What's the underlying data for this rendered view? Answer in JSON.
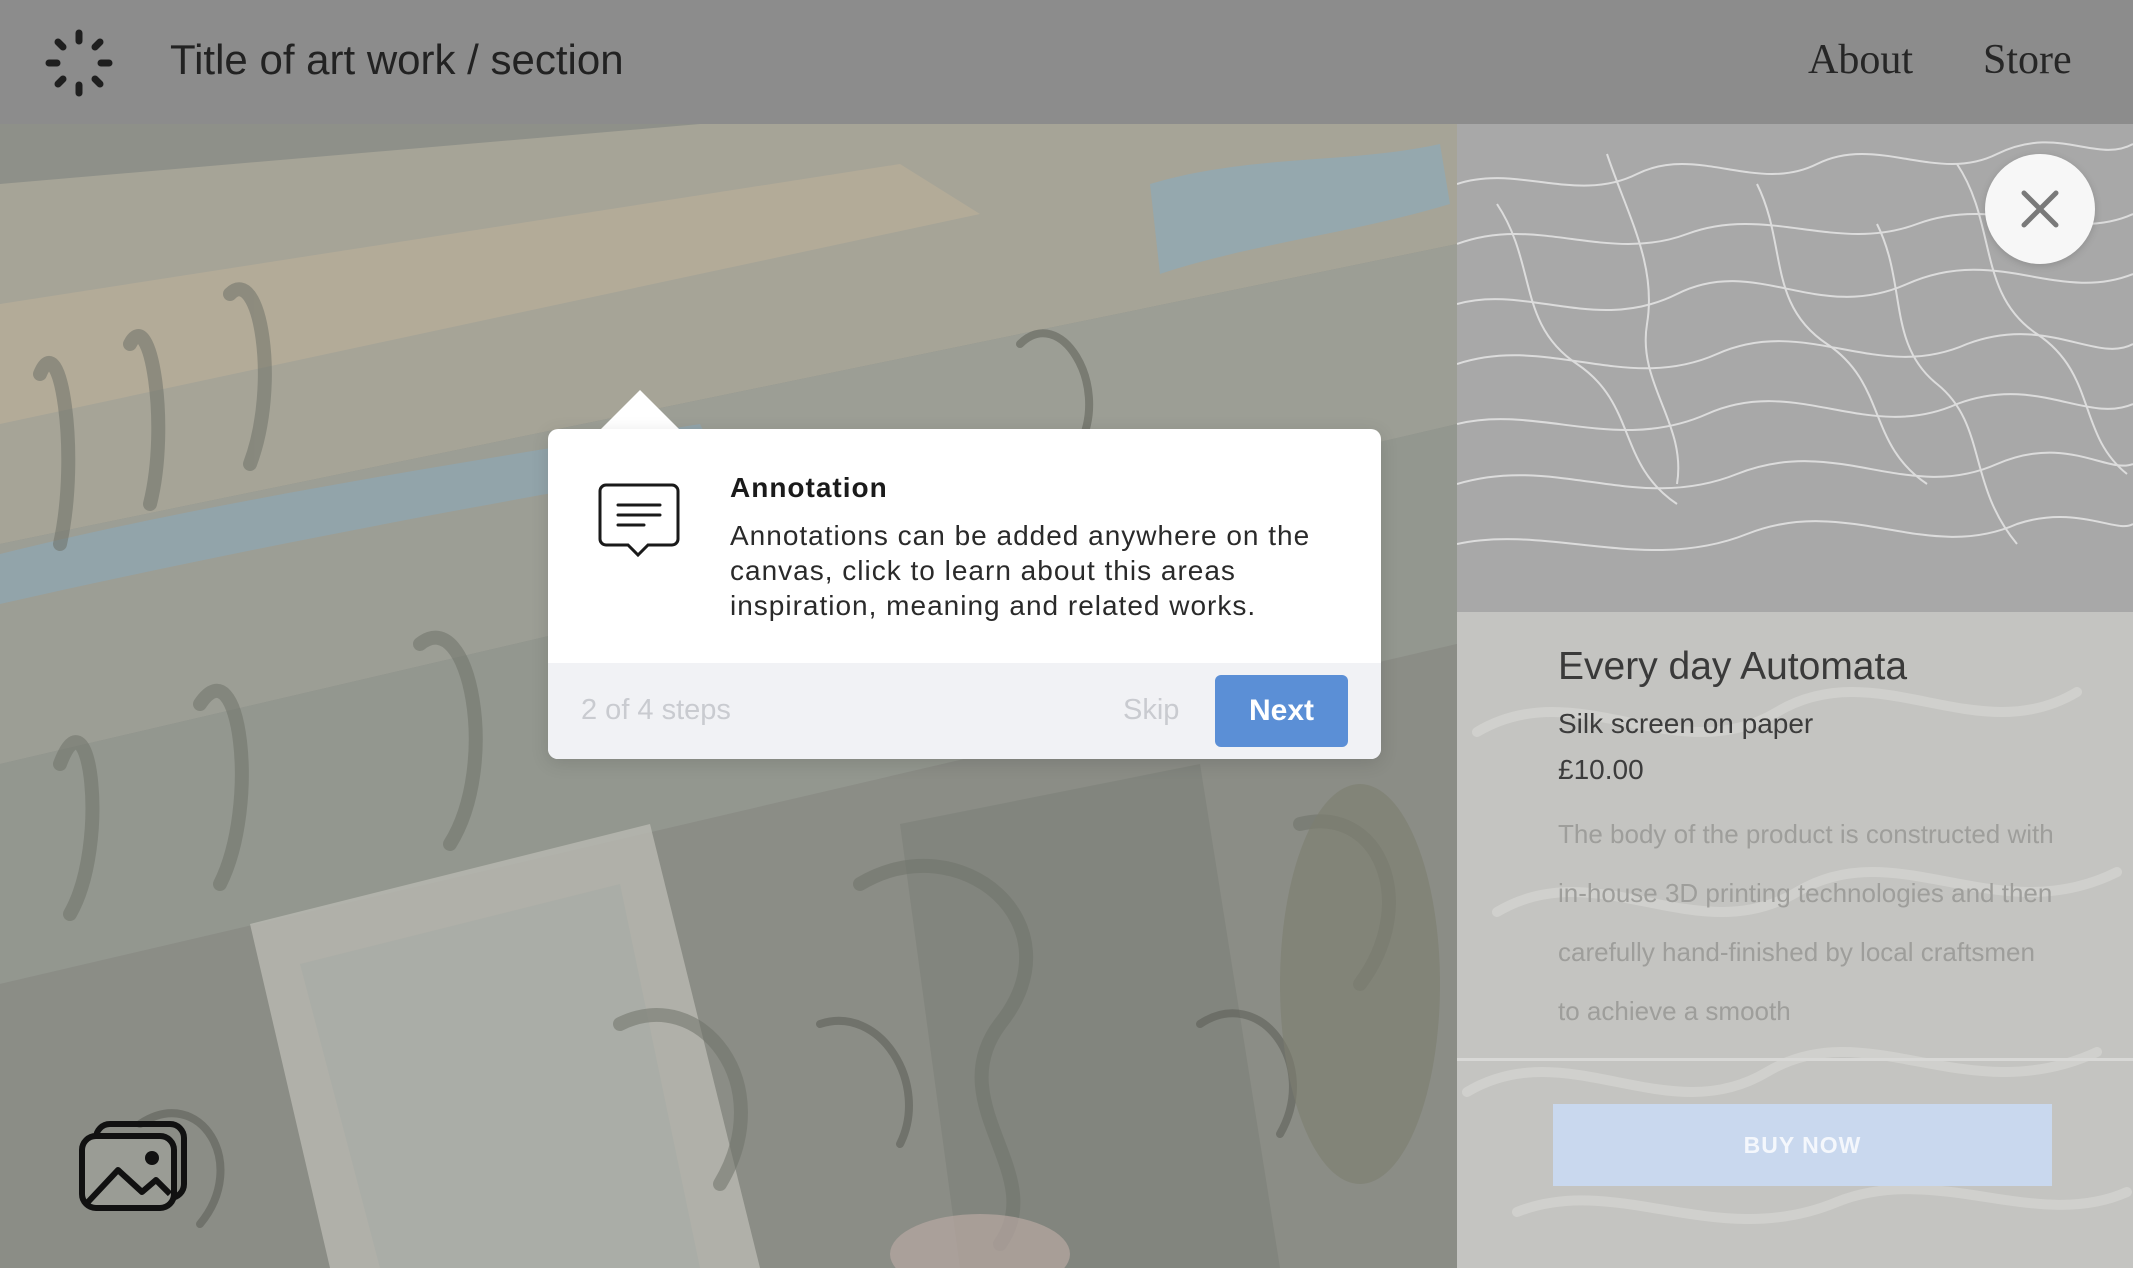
{
  "header": {
    "title": "Title of art work / section",
    "nav": [
      {
        "label": "About"
      },
      {
        "label": "Store"
      }
    ]
  },
  "icons": {
    "logo": "loading-ring-icon",
    "gallery": "image-gallery-icon",
    "close": "close-icon",
    "annotation": "comment-bubble-icon"
  },
  "tooltip": {
    "title": "Annotation",
    "body": "Annotations can be added anywhere on the canvas, click to learn about this areas inspiration, meaning and related works.",
    "steps": "2 of 4 steps",
    "skip_label": "Skip",
    "next_label": "Next"
  },
  "product": {
    "title": "Every day Automata",
    "medium": "Silk screen on paper",
    "price": "£10.00",
    "description": "The body of the product is constructed with in-house 3D printing technologies and then carefully hand-finished by local craftsmen to achieve a smooth",
    "buy_label": "BUY NOW"
  },
  "colors": {
    "header_bg": "#8c8c8c",
    "accent": "#5b8fd6",
    "buy_button": "#c9d8ee"
  }
}
